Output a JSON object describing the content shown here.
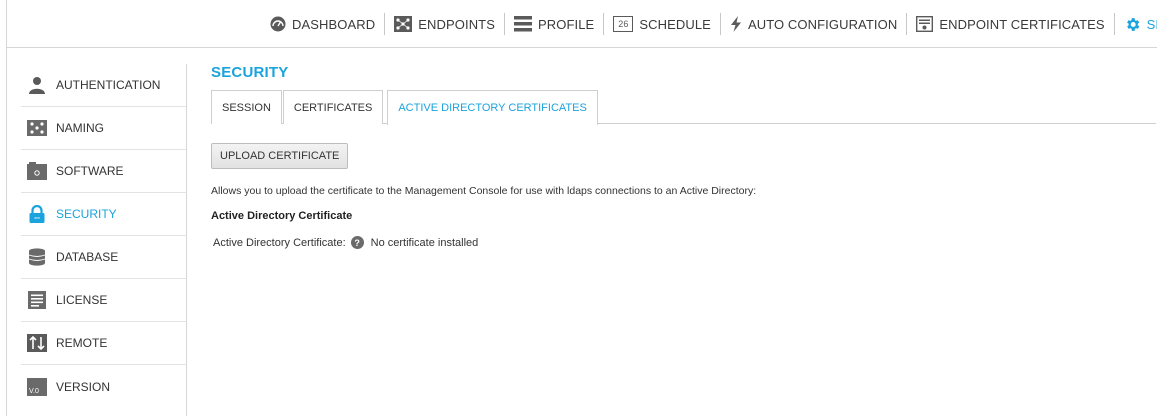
{
  "nav": {
    "items": [
      {
        "label": "DASHBOARD",
        "icon": "dashboard-icon"
      },
      {
        "label": "ENDPOINTS",
        "icon": "endpoints-icon"
      },
      {
        "label": "PROFILE",
        "icon": "profile-icon"
      },
      {
        "label": "SCHEDULE",
        "icon": "calendar-icon",
        "icon_text": "26"
      },
      {
        "label": "AUTO CONFIGURATION",
        "icon": "lightning-icon"
      },
      {
        "label": "ENDPOINT CERTIFICATES",
        "icon": "certificate-icon"
      },
      {
        "label": "SETTINGS",
        "icon": "gear-icon",
        "active": true
      }
    ]
  },
  "sidebar": {
    "items": [
      {
        "label": "AUTHENTICATION",
        "icon": "user-icon"
      },
      {
        "label": "NAMING",
        "icon": "naming-icon"
      },
      {
        "label": "SOFTWARE",
        "icon": "software-icon"
      },
      {
        "label": "SECURITY",
        "icon": "lock-icon",
        "active": true
      },
      {
        "label": "DATABASE",
        "icon": "database-icon"
      },
      {
        "label": "LICENSE",
        "icon": "license-icon"
      },
      {
        "label": "REMOTE",
        "icon": "remote-icon"
      },
      {
        "label": "VERSION",
        "icon": "version-icon",
        "icon_text": "V.0"
      }
    ]
  },
  "main": {
    "title": "SECURITY",
    "tabs": [
      {
        "label": "SESSION"
      },
      {
        "label": "CERTIFICATES"
      },
      {
        "label": "ACTIVE DIRECTORY CERTIFICATES",
        "active": true
      }
    ],
    "upload_label": "UPLOAD CERTIFICATE",
    "description": "Allows you to upload the certificate to the Management Console for use with ldaps connections to an Active Directory:",
    "section_title": "Active Directory Certificate",
    "field_label": "Active Directory Certificate:",
    "help_glyph": "?",
    "field_value": "No certificate installed"
  },
  "colors": {
    "accent": "#1aa3dc",
    "text": "#333333",
    "icon_gray": "#5a5a5a"
  }
}
